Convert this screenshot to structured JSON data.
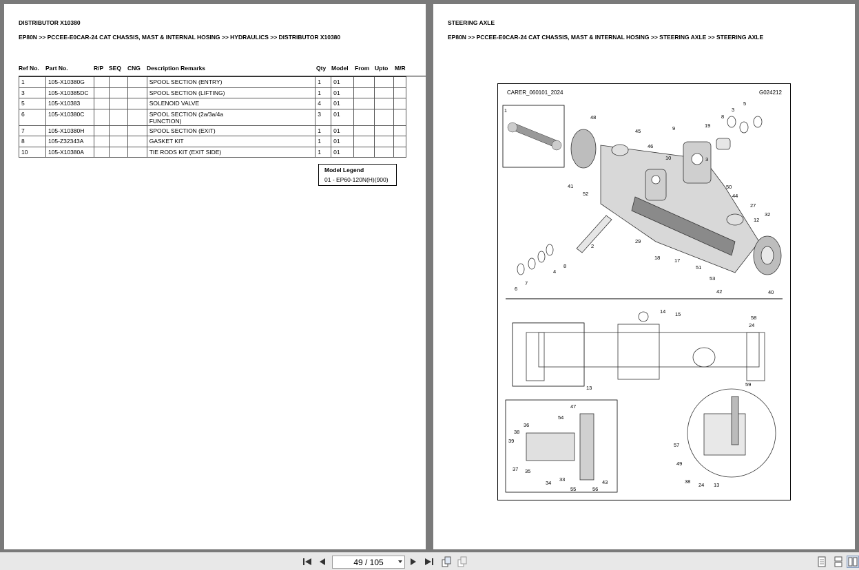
{
  "left_page": {
    "heading": "DISTRIBUTOR X10380",
    "breadcrumb": "EP80N >> PCCEE-E0CAR-24 CAT CHASSIS, MAST & INTERNAL HOSING >> HYDRAULICS >> DISTRIBUTOR X10380",
    "columns": [
      "Ref No.",
      "Part No.",
      "R/P",
      "SEQ",
      "CNG",
      "Description Remarks",
      "Qty",
      "Model",
      "From",
      "Upto",
      "M/R"
    ],
    "rows": [
      {
        "ref": "1",
        "part": "105-X10380G",
        "desc": "SPOOL SECTION (ENTRY)",
        "qty": "1",
        "model": "01"
      },
      {
        "ref": "3",
        "part": "105-X10385DC",
        "desc": "SPOOL SECTION (LIFTING)",
        "qty": "1",
        "model": "01"
      },
      {
        "ref": "5",
        "part": "105-X10383",
        "desc": "SOLENOID VALVE",
        "qty": "4",
        "model": "01"
      },
      {
        "ref": "6",
        "part": "105-X10380C",
        "desc": "SPOOL SECTION (2a/3a/4a",
        "desc2": "FUNCTION)",
        "qty": "3",
        "model": "01"
      },
      {
        "ref": "7",
        "part": "105-X10380H",
        "desc": "SPOOL SECTION (EXIT)",
        "qty": "1",
        "model": "01"
      },
      {
        "ref": "8",
        "part": "105-Z32343A",
        "desc": "GASKET KIT",
        "qty": "1",
        "model": "01"
      },
      {
        "ref": "10",
        "part": "105-X10380A",
        "desc": "TIE RODS KIT (EXIT SIDE)",
        "qty": "1",
        "model": "01"
      }
    ],
    "legend": {
      "title": "Model Legend",
      "entry": "01 - EP60-120N(H)(900)"
    }
  },
  "right_page": {
    "heading": "STEERING AXLE",
    "breadcrumb": "EP80N >> PCCEE-E0CAR-24 CAT CHASSIS, MAST & INTERNAL HOSING >> STEERING AXLE >> STEERING AXLE",
    "diagram": {
      "source_label": "CARER_060101_2024",
      "figure_code": "G024212",
      "inset_number": "1",
      "callouts_top": [
        "48",
        "45",
        "46",
        "9",
        "19",
        "8",
        "3",
        "5",
        "10",
        "3",
        "41",
        "52",
        "50",
        "44",
        "27",
        "32",
        "12",
        "2",
        "29",
        "18",
        "17",
        "51",
        "53",
        "8",
        "4",
        "7",
        "6",
        "42",
        "40"
      ],
      "callouts_bottom": [
        "14",
        "15",
        "58",
        "24",
        "13",
        "59",
        "47",
        "54",
        "36",
        "38",
        "39",
        "37",
        "35",
        "34",
        "33",
        "55",
        "56",
        "43",
        "57",
        "49",
        "38",
        "24",
        "13"
      ]
    }
  },
  "toolbar": {
    "page_indicator": "49 / 105",
    "icons": [
      "first-page-icon",
      "prev-page-icon",
      "next-page-icon",
      "last-page-icon",
      "rotate-icon",
      "fit-icon",
      "single-page-icon",
      "continuous-page-icon",
      "two-page-icon"
    ]
  }
}
